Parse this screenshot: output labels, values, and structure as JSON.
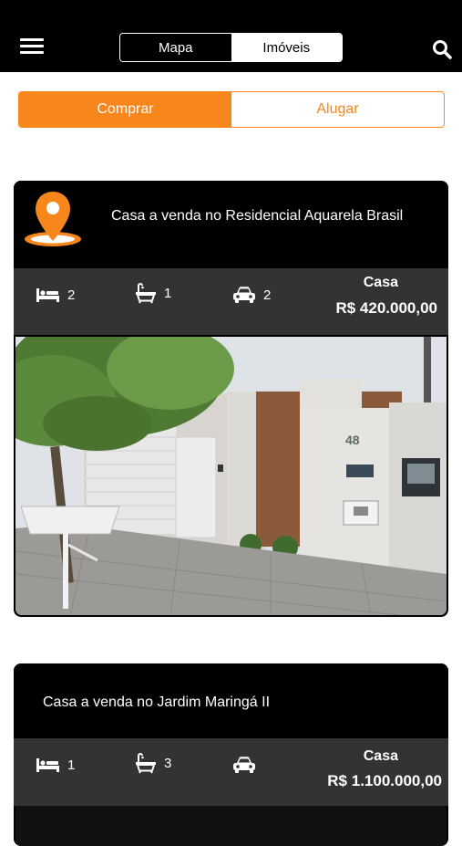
{
  "nav": {
    "menu_icon": "hamburger-menu-icon",
    "segments": [
      {
        "label": "Mapa",
        "selected": false
      },
      {
        "label": "Imóveis",
        "selected": true
      }
    ],
    "search_icon": "search-icon"
  },
  "filter": {
    "buy_label": "Comprar",
    "rent_label": "Alugar",
    "selected": "Comprar"
  },
  "colors": {
    "accent": "#f7861c",
    "bar": "#000000",
    "info_row": "#333333"
  },
  "listings": [
    {
      "title": "Casa a venda no Residencial Aquarela Brasil",
      "has_pin_icon": true,
      "bedrooms": "2",
      "bathrooms": "1",
      "parking": "2",
      "type": "Casa",
      "price": "R$ 420.000,00",
      "photo_house_number": "48"
    },
    {
      "title": "Casa a venda no Jardim Maringá II",
      "has_pin_icon": false,
      "bedrooms": "1",
      "bathrooms": "3",
      "parking": "",
      "type": "Casa",
      "price": "R$ 1.100.000,00"
    }
  ]
}
